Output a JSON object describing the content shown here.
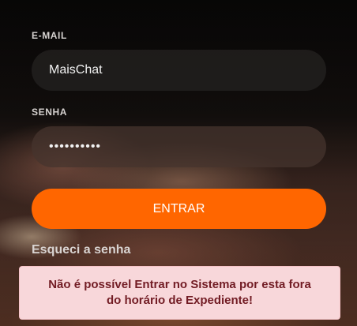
{
  "form": {
    "email_label": "E-MAIL",
    "email_value": "MaisChat",
    "password_label": "SENHA",
    "password_masked": "••••••••••",
    "submit_label": "ENTRAR",
    "forgot_label": "Esqueci a senha"
  },
  "alert": {
    "message": "Não é possível Entrar no Sistema por esta fora do horário de Expediente!"
  },
  "colors": {
    "accent": "#ff6600",
    "alert_bg": "#f8d7da",
    "alert_text": "#721c24"
  }
}
